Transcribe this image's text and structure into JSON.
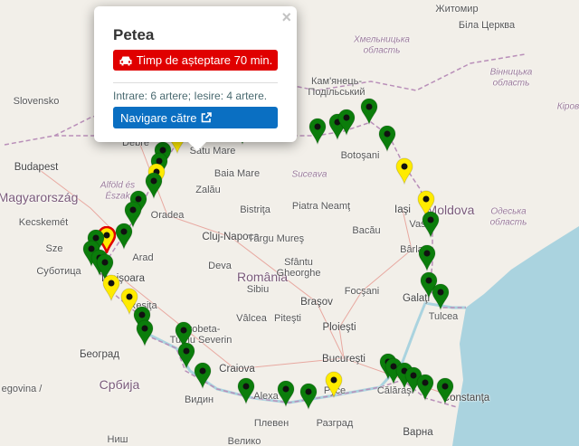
{
  "popup": {
    "title": "Petea",
    "wait_label": "Timp de așteptare 70 min.",
    "wait_icon": "car-icon",
    "info": "Intrare: 6 artere; Iesire: 4 artere.",
    "nav_label": "Navigare către",
    "nav_icon": "external-link-icon",
    "close_label": "×"
  },
  "colors": {
    "ok": "#0b7d0b",
    "medium": "#ffeb00",
    "high": "#e00000",
    "nav": "#0a6fc2",
    "water": "#aad3df"
  },
  "labels": [
    "Житомир",
    "Біла Церква",
    "Хмельницька",
    "область",
    "Кам'янець-",
    "Подільський",
    "Вінницька",
    "область",
    "Кіров",
    "Botoşani",
    "Suceava",
    "Iaşi",
    "Moldova",
    "Vaslui",
    "Одеська",
    "область",
    "Bârlad",
    "Galaţi",
    "Tulcea",
    "Focşani",
    "Bacău",
    "Piatra Neamţ",
    "Bistriţa",
    "Cluj-Napoca",
    "Târgu Mureş",
    "România",
    "Sfântu",
    "Gheorghe",
    "Braşov",
    "Ploieşti",
    "Bucureşti",
    "Călăraşi",
    "Constanţa",
    "Варна",
    "Разград",
    "Плевен",
    "Alexa",
    "Craiova",
    "Видин",
    "Drobeta-",
    "Turnu Severin",
    "Reşiţa",
    "Timişoara",
    "Arad",
    "Oradea",
    "Zalău",
    "Baia Mare",
    "Satu Mare",
    "Debre",
    "Budapest",
    "Magyarország",
    "Kecskemét",
    "Sze",
    "Суботица",
    "Београд",
    "Србија",
    "Slovensko",
    "Alföld és",
    "Észak",
    "Vâlcea",
    "Piteşti",
    "Deva",
    "Русе",
    "egovina /",
    "Велико",
    "Ниш",
    "Sibiu"
  ]
}
